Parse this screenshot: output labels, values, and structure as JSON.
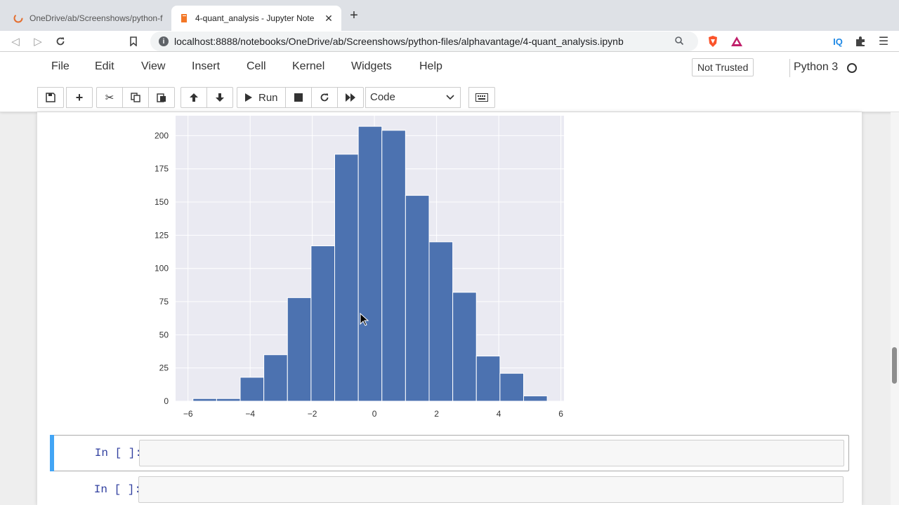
{
  "browser": {
    "tabs": [
      {
        "title": "OneDrive/ab/Screenshows/python-f",
        "active": false
      },
      {
        "title": "4-quant_analysis - Jupyter Note",
        "active": true
      }
    ],
    "url": "localhost:8888/notebooks/OneDrive/ab/Screenshows/python-files/alphavantage/4-quant_analysis.ipynb",
    "extension_label": "IQ"
  },
  "jupyter": {
    "menu": [
      "File",
      "Edit",
      "View",
      "Insert",
      "Cell",
      "Kernel",
      "Widgets",
      "Help"
    ],
    "trust_label": "Not Trusted",
    "kernel_name": "Python 3",
    "run_label": "Run",
    "cell_type": "Code"
  },
  "cells": [
    {
      "prompt": "In [ ]:"
    },
    {
      "prompt": "In [ ]:"
    }
  ],
  "colors": {
    "bar": "#4c72b0",
    "plot_bg": "#eaeaf2",
    "grid": "#ffffff",
    "cell_selected_accent": "#42a5f5",
    "prompt": "#303f9f"
  },
  "chart_data": {
    "type": "bar",
    "style": "histogram",
    "bin_edges": [
      -5.84,
      -5.08,
      -4.32,
      -3.56,
      -2.8,
      -2.04,
      -1.28,
      -0.52,
      0.24,
      1.0,
      1.76,
      2.52,
      3.28,
      4.04,
      4.8,
      5.56
    ],
    "values": [
      2,
      2,
      18,
      35,
      78,
      117,
      186,
      207,
      204,
      155,
      120,
      82,
      34,
      21,
      4
    ],
    "xlim": [
      -6.4,
      6.1
    ],
    "ylim": [
      0,
      215
    ],
    "xticks": [
      -6,
      -4,
      -2,
      0,
      2,
      4,
      6
    ],
    "xtick_labels": [
      "−6",
      "−4",
      "−2",
      "0",
      "2",
      "4",
      "6"
    ],
    "yticks": [
      0,
      25,
      50,
      75,
      100,
      125,
      150,
      175,
      200
    ],
    "ytick_labels": [
      "0",
      "25",
      "50",
      "75",
      "100",
      "125",
      "150",
      "175",
      "200"
    ],
    "grid": true,
    "title": "",
    "xlabel": "",
    "ylabel": ""
  }
}
